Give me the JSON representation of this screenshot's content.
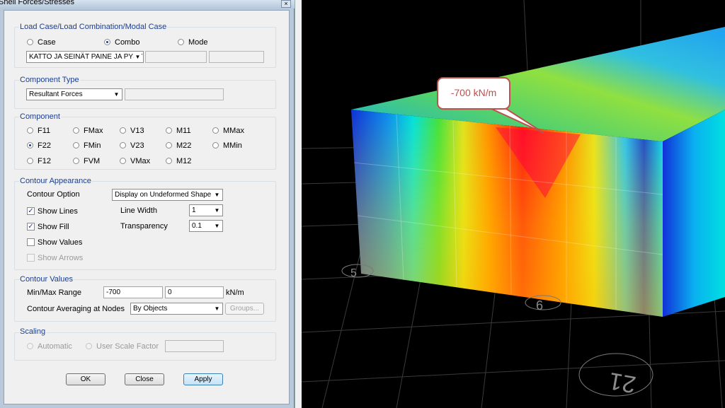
{
  "window": {
    "title": "Shell Forces/Stresses",
    "close_glyph": "×"
  },
  "load_case": {
    "title": "Load Case/Load Combination/Modal Case",
    "options": [
      "Case",
      "Combo",
      "Mode"
    ],
    "selected": "Combo",
    "combo_value": "KATTO JA SEINÄT PAINE JA PYSY"
  },
  "component_type": {
    "title": "Component Type",
    "value": "Resultant Forces"
  },
  "component": {
    "title": "Component",
    "options": [
      "F11",
      "FMax",
      "V13",
      "M11",
      "MMax",
      "F22",
      "FMin",
      "V23",
      "M22",
      "MMin",
      "F12",
      "FVM",
      "VMax",
      "M12"
    ],
    "selected": "F22"
  },
  "contour_appearance": {
    "title": "Contour Appearance",
    "option_label": "Contour Option",
    "option_value": "Display on Undeformed Shape",
    "show_lines": "Show Lines",
    "show_fill": "Show Fill",
    "show_values": "Show Values",
    "show_arrows": "Show Arrows",
    "line_width_label": "Line Width",
    "line_width_value": "1",
    "transparency_label": "Transparency",
    "transparency_value": "0.1",
    "check_glyph": "✓"
  },
  "contour_values": {
    "title": "Contour Values",
    "range_label": "Min/Max Range",
    "min": "-700",
    "max": "0",
    "unit": "kN/m",
    "averaging_label": "Contour Averaging at Nodes",
    "averaging_value": "By Objects",
    "groups_button": "Groups..."
  },
  "scaling": {
    "title": "Scaling",
    "automatic": "Automatic",
    "user_scale": "User Scale Factor"
  },
  "buttons": {
    "ok": "OK",
    "close": "Close",
    "apply": "Apply"
  },
  "viewport": {
    "callout": "-700 kN/m",
    "grid_label_a": "21",
    "grid_label_b": "6",
    "grid_label_c": "5"
  },
  "dropdown_arrow": "▼"
}
